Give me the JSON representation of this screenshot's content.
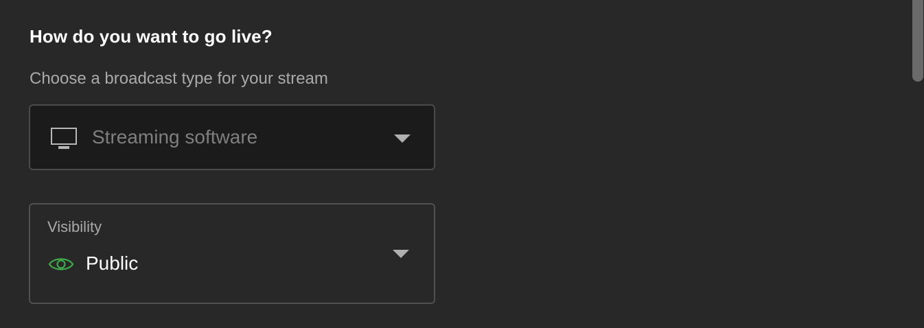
{
  "header": {
    "title": "How do you want to go live?",
    "subtitle": "Choose a broadcast type for your stream"
  },
  "broadcast_type": {
    "selected": "Streaming software",
    "icon": "monitor-icon"
  },
  "visibility": {
    "label": "Visibility",
    "selected": "Public",
    "icon": "eye-icon",
    "icon_color": "#3ea84a"
  },
  "colors": {
    "background": "#282828",
    "dropdown_background": "#1b1b1b",
    "border": "#4b4b4b",
    "accent_green": "#3ea84a"
  }
}
